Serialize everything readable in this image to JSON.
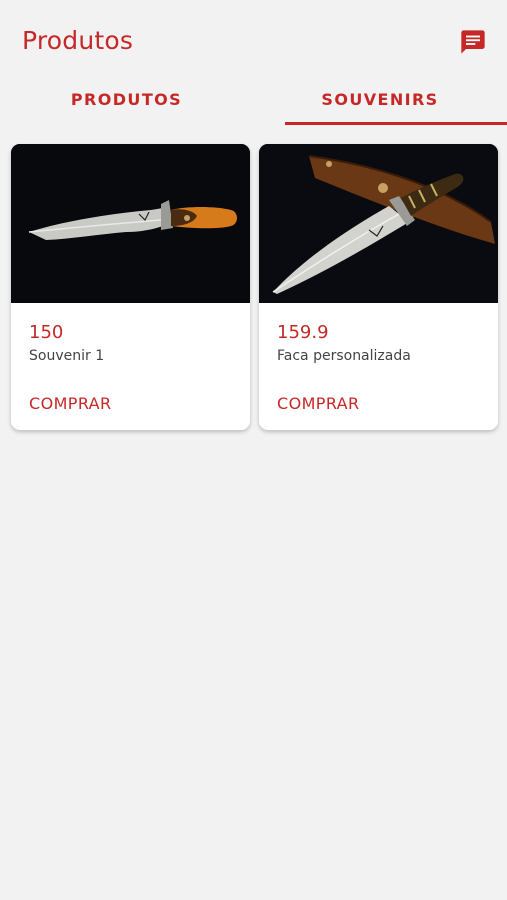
{
  "appbar": {
    "title": "Produtos",
    "chat_icon": "chat-icon"
  },
  "tabs": [
    {
      "label": "PRODUTOS",
      "selected": false
    },
    {
      "label": "SOUVENIRS",
      "selected": true
    }
  ],
  "products": [
    {
      "price": "150",
      "name": "Souvenir 1",
      "buy_label": "COMPRAR"
    },
    {
      "price": "159.9",
      "name": "Faca personalizada",
      "buy_label": "COMPRAR"
    }
  ],
  "colors": {
    "accent": "#c62828",
    "background": "#f2f2f2",
    "card": "#ffffff"
  }
}
